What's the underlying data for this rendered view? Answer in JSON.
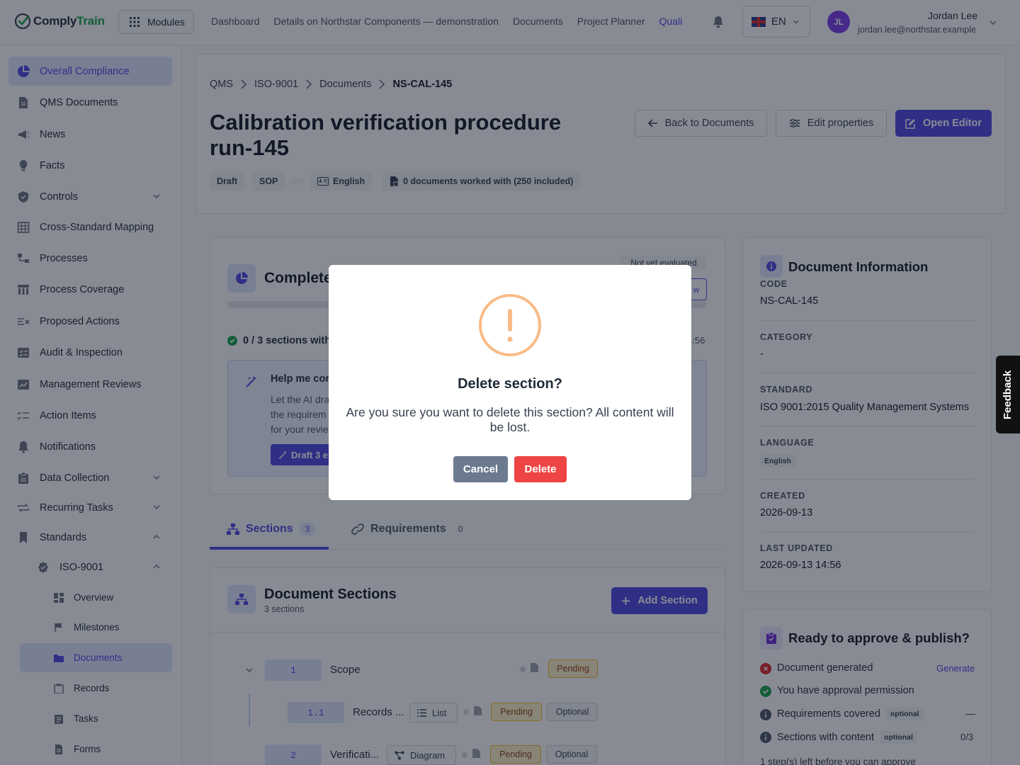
{
  "brand": {
    "part1": "Comply",
    "part2": "Train"
  },
  "topbar": {
    "modules_label": "Modules",
    "nav": [
      "Dashboard",
      "Details on Northstar Components — demonstration",
      "Documents",
      "Project Planner",
      "Quali"
    ],
    "language": "EN",
    "user_initials": "JL",
    "user_name": "Jordan Lee",
    "user_email": "jordan.lee@northstar.example"
  },
  "sidebar": {
    "items": [
      "Overall Compliance",
      "QMS Documents",
      "News",
      "Facts",
      "Controls",
      "Cross-Standard Mapping",
      "Processes",
      "Process Coverage",
      "Proposed Actions",
      "Audit & Inspection",
      "Management Reviews",
      "Action Items",
      "Notifications",
      "Data Collection",
      "Recurring Tasks",
      "Standards"
    ],
    "standard": "ISO-9001",
    "sub_items": [
      "Overview",
      "Milestones",
      "Documents",
      "Records",
      "Tasks",
      "Forms"
    ]
  },
  "breadcrumb": [
    "QMS",
    "ISO-9001",
    "Documents",
    "NS-CAL-145"
  ],
  "page": {
    "title": "Calibration verification procedure run-145",
    "back_label": "Back to Documents",
    "edit_label": "Edit properties",
    "open_label": "Open Editor",
    "tags": [
      "Draft",
      "SOP",
      "English",
      "0 documents worked with (250 included)"
    ]
  },
  "completeness": {
    "title": "Complete",
    "status": "Not yet evaluated",
    "btn_fragment": "w",
    "sections_text": "0 / 3 sections with",
    "time_fragment": "4:56",
    "help_title": "Help me con",
    "help_line1": "Let the AI dra",
    "help_line2": "the requirem",
    "help_line3": "for your revie",
    "draft_btn": "Draft 3 e"
  },
  "tabs": [
    {
      "label": "Sections",
      "count": "3"
    },
    {
      "label": "Requirements",
      "count": "0"
    }
  ],
  "sections": {
    "title": "Document Sections",
    "subtitle": "3 sections",
    "add_label": "Add Section",
    "rows": [
      {
        "num": "1",
        "name": "Scope",
        "status": "Pending"
      },
      {
        "num": "1.1",
        "name": "Records ...",
        "type": "List",
        "status": "Pending",
        "optional": "Optional"
      },
      {
        "num": "2",
        "name": "Verificati...",
        "type": "Diagram",
        "status": "Pending",
        "optional": "Optional"
      }
    ]
  },
  "doc_info": {
    "title": "Document Information",
    "code_label": "CODE",
    "code": "NS-CAL-145",
    "category_label": "CATEGORY",
    "category": "-",
    "standard_label": "STANDARD",
    "standard": "ISO 9001:2015 Quality Management Systems",
    "language_label": "LANGUAGE",
    "language": "English",
    "created_label": "CREATED",
    "created": "2026-09-13",
    "updated_label": "LAST UPDATED",
    "updated": "2026-09-13 14:56"
  },
  "approve": {
    "title": "Ready to approve & publish?",
    "rows": [
      {
        "label": "Document generated",
        "action": "Generate"
      },
      {
        "label": "You have approval permission"
      },
      {
        "label": "Requirements covered",
        "tag": "optional",
        "value": "—"
      },
      {
        "label": "Sections with content",
        "tag": "optional",
        "value": "0/3"
      }
    ],
    "footer": "1 step(s) left before you can approve"
  },
  "modal": {
    "title": "Delete section?",
    "message": "Are you sure you want to delete this section? All content will be lost.",
    "cancel": "Cancel",
    "delete": "Delete"
  },
  "feedback": "Feedback",
  "colors": {
    "accent": "#4f46e5",
    "danger": "#ef4444",
    "warning": "#f6b26b",
    "success": "#16a34a"
  }
}
